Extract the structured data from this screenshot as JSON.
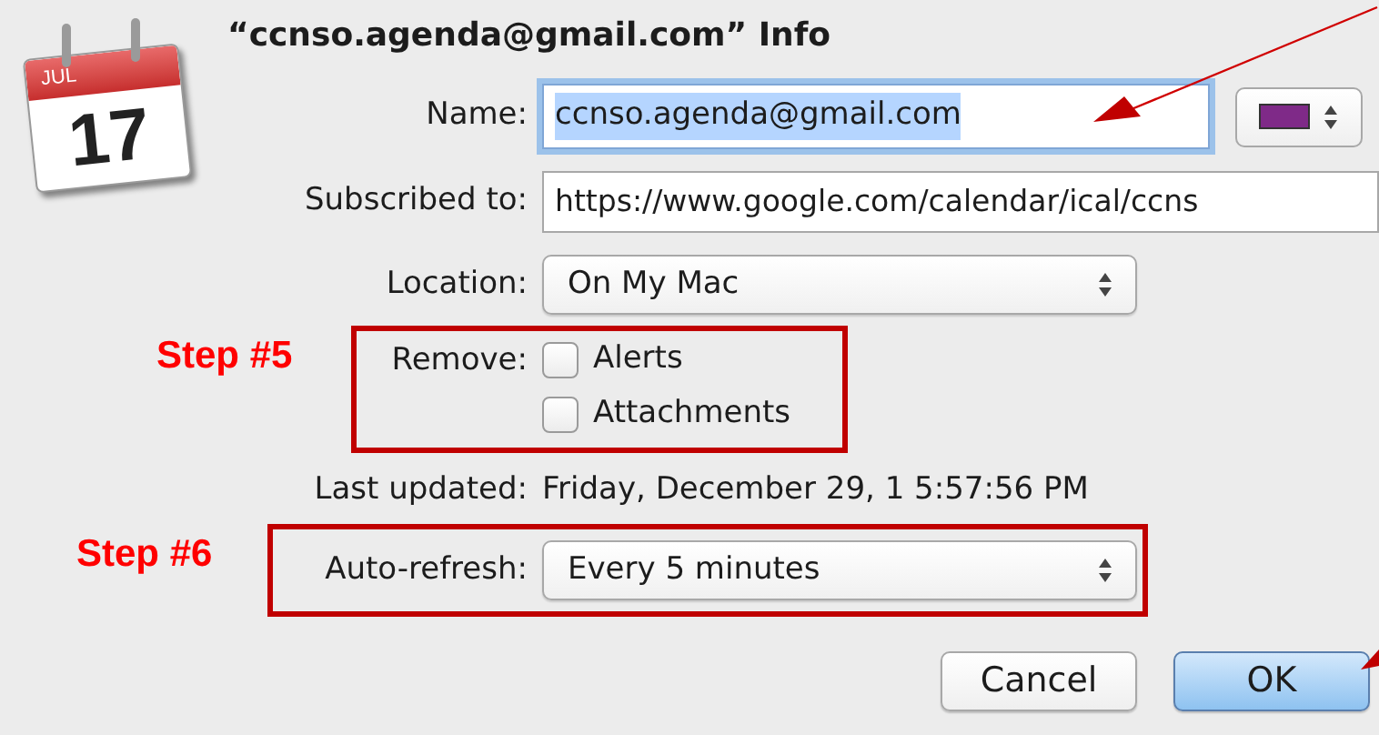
{
  "window": {
    "title": "“ccnso.agenda@gmail.com” Info"
  },
  "icon": {
    "month": "JUL",
    "day": "17"
  },
  "name": {
    "label": "Name:",
    "value": "ccnso.agenda@gmail.com",
    "focused": true
  },
  "color_popup": {
    "color": "#7f2a88"
  },
  "subscribed": {
    "label": "Subscribed to:",
    "value": "https://www.google.com/calendar/ical/ccns"
  },
  "location": {
    "label": "Location:",
    "value": "On My Mac"
  },
  "remove": {
    "label": "Remove:",
    "options": [
      {
        "label": "Alerts",
        "checked": false
      },
      {
        "label": "Attachments",
        "checked": false
      }
    ]
  },
  "last_updated": {
    "label": "Last updated:",
    "value": "Friday, December 29, 1 5:57:56 PM"
  },
  "auto_refresh": {
    "label": "Auto-refresh:",
    "value": "Every 5 minutes"
  },
  "buttons": [
    {
      "label": "Cancel",
      "default": false
    },
    {
      "label": "OK",
      "default": true
    }
  ],
  "annotations": [
    {
      "text": "Step #5"
    },
    {
      "text": "Step #6"
    }
  ]
}
